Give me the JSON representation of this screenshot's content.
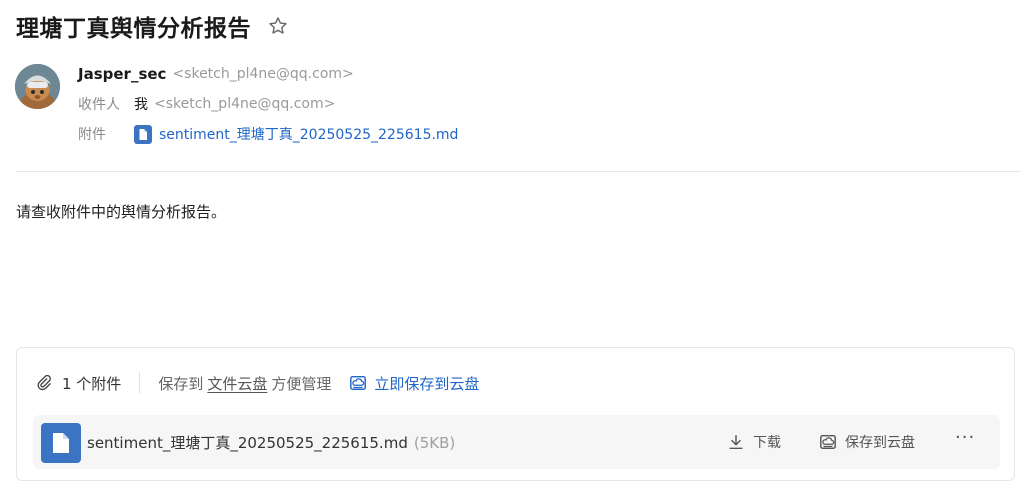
{
  "email": {
    "subject": "理塘丁真舆情分析报告",
    "sender": {
      "name": "Jasper_sec",
      "address": "<sketch_pl4ne@qq.com>"
    },
    "recipient": {
      "label": "收件人",
      "name": "我",
      "address": "<sketch_pl4ne@qq.com>"
    },
    "attachment_row": {
      "label": "附件",
      "filename": "sentiment_理塘丁真_20250525_225615.md"
    },
    "body": "请查收附件中的舆情分析报告。"
  },
  "attachments_panel": {
    "count_label": "1 个附件",
    "save_prefix": "保存到",
    "save_link": "文件云盘",
    "save_suffix": "方便管理",
    "cloud_save_label": "立即保存到云盘",
    "items": [
      {
        "filename": "sentiment_理塘丁真_20250525_225615.md",
        "size": "(5KB)",
        "download_label": "下载",
        "save_cloud_label": "保存到云盘",
        "more_label": "···"
      }
    ]
  },
  "icons": {
    "star": "star-outline-icon",
    "clip": "paperclip-icon",
    "cloud": "cloud-disk-icon",
    "file": "document-icon",
    "download": "download-icon",
    "more": "more-horizontal-icon"
  },
  "colors": {
    "link": "#1f66c8",
    "file_icon": "#3c74c4"
  }
}
